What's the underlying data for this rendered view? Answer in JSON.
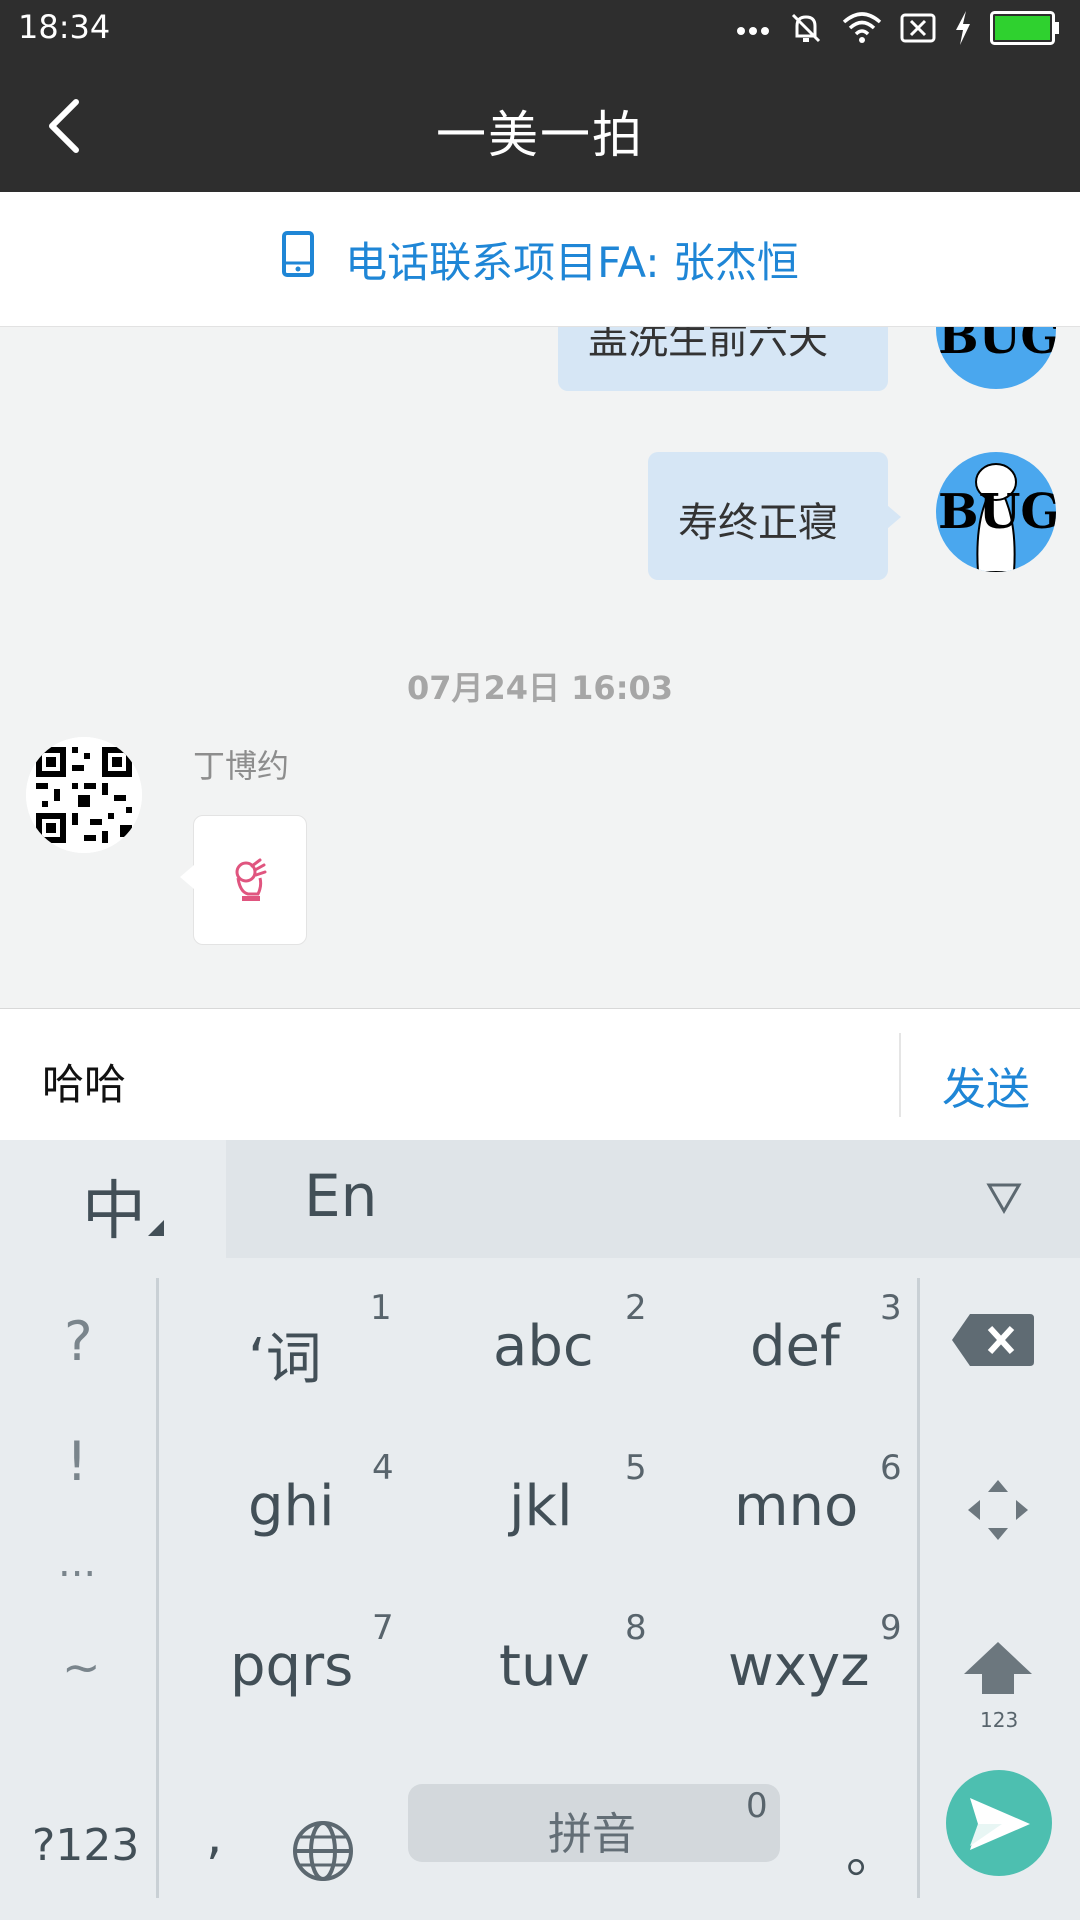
{
  "status_bar": {
    "time": "18:34",
    "icons": [
      "more-dots-icon",
      "mute-icon",
      "wifi-icon",
      "sim-off-icon",
      "charging-icon",
      "battery-icon"
    ],
    "battery_color": "#2fd12f"
  },
  "header": {
    "title": "一美一拍"
  },
  "contact_bar": {
    "label": "电话联系项目FA: 张杰恒",
    "icon": "phone-icon",
    "color": "#1f86d6"
  },
  "chat": {
    "messages": [
      {
        "sender": "me",
        "text": "盖洗生前六天",
        "partial": true
      },
      {
        "sender": "me",
        "text": "寿终正寝"
      },
      {
        "type": "timestamp",
        "text": "07月24日 16:03"
      },
      {
        "sender": "other",
        "name": "丁博约",
        "content": "emoji-image"
      }
    ],
    "avatar_text": "BUG"
  },
  "input": {
    "value": "哈哈",
    "send_label": "发送"
  },
  "keyboard": {
    "mode_label": "中",
    "candidate": "En",
    "punct": [
      "?",
      "!",
      "...",
      "~"
    ],
    "keys": [
      {
        "label": "‘词",
        "num": "1"
      },
      {
        "label": "abc",
        "num": "2"
      },
      {
        "label": "def",
        "num": "3"
      },
      {
        "label": "ghi",
        "num": "4"
      },
      {
        "label": "jkl",
        "num": "5"
      },
      {
        "label": "mno",
        "num": "6"
      },
      {
        "label": "pqrs",
        "num": "7"
      },
      {
        "label": "tuv",
        "num": "8"
      },
      {
        "label": "wxyz",
        "num": "9"
      }
    ],
    "shift_sub": "123",
    "bottom": {
      "sym": "?123",
      "comma": ",",
      "space": "拼音",
      "space_num": "0",
      "period": "。"
    },
    "accent_color": "#4dbfb0"
  }
}
